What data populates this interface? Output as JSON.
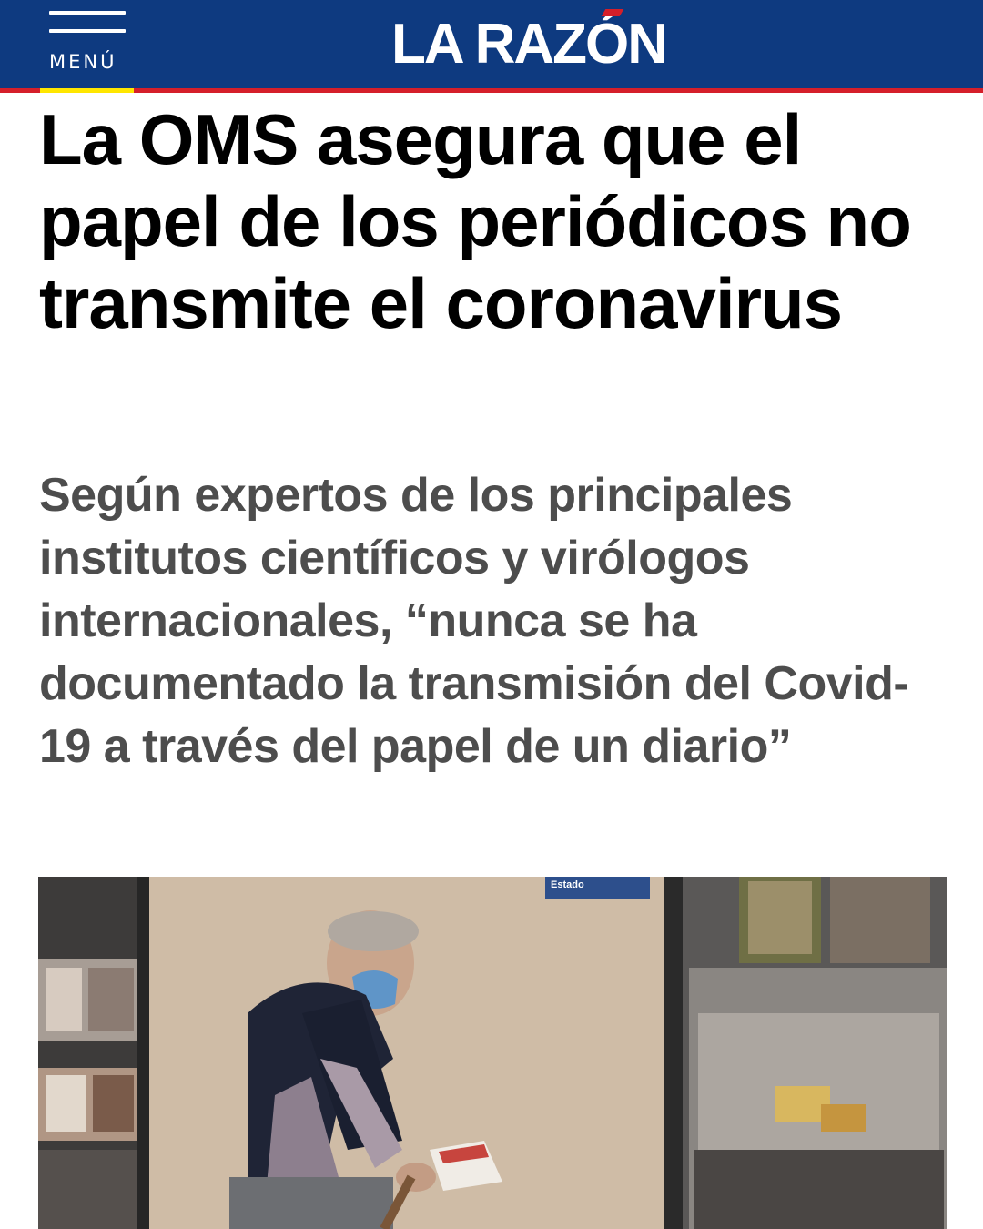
{
  "header": {
    "menu_label": "MENÚ",
    "logo_text": "LA RAZÓN",
    "brand_color": "#0e3a80",
    "accent_red": "#d51f2a",
    "accent_yellow": "#ffe600",
    "menu_icon": "hamburger-icon"
  },
  "article": {
    "headline": "La OMS asegura que el papel de los periódicos no transmite el coronavirus",
    "subheadline": "Según expertos de los principales institutos científicos y virólogos internacionales, “nunca se ha documentado la transmisión del Covid-19 a través del papel de un diario”"
  },
  "photo": {
    "sign_text": "Estado"
  }
}
